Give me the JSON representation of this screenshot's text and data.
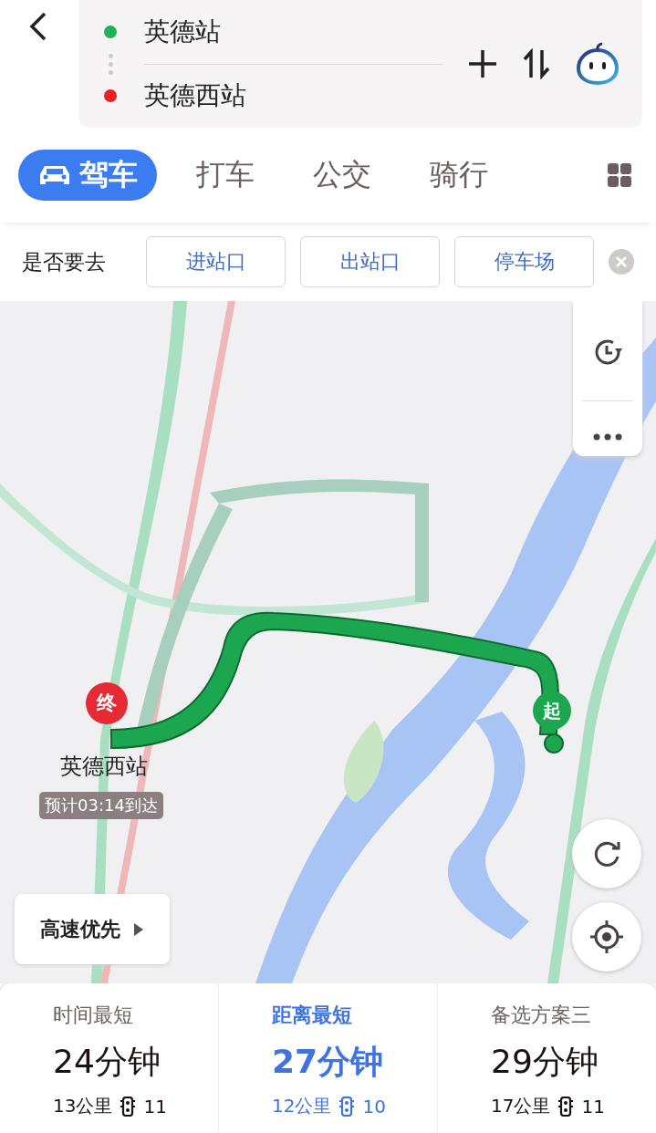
{
  "route": {
    "start": "英德站",
    "end": "英德西站"
  },
  "modes": [
    {
      "label": "驾车",
      "selected": true
    },
    {
      "label": "打车",
      "selected": false
    },
    {
      "label": "公交",
      "selected": false
    },
    {
      "label": "骑行",
      "selected": false
    }
  ],
  "destination_prompt": {
    "label": "是否要去",
    "options": [
      "进站口",
      "出站口",
      "停车场"
    ]
  },
  "map": {
    "kind": "picture",
    "end_marker": "终",
    "end_name": "英德西站",
    "eta": "预计03:14到达",
    "start_marker": "起",
    "preference_button": "高速优先"
  },
  "plans": [
    {
      "title": "时间最短",
      "duration": "24分钟",
      "distance": "13公里",
      "lights": "11",
      "selected": false
    },
    {
      "title": "距离最短",
      "duration": "27分钟",
      "distance": "12公里",
      "lights": "10",
      "selected": true
    },
    {
      "title": "备选方案三",
      "duration": "29分钟",
      "distance": "17公里",
      "lights": "11",
      "selected": false
    }
  ]
}
